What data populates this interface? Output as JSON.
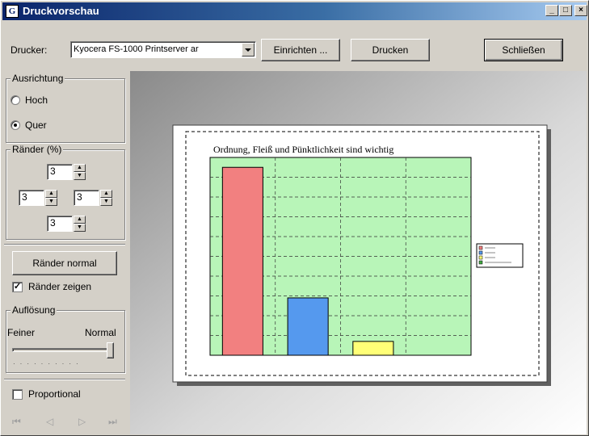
{
  "window": {
    "title": "Druckvorschau",
    "icon_letter": "G",
    "minimize_glyph": "_",
    "maximize_glyph": "□",
    "close_glyph": "×"
  },
  "toolbar": {
    "printer_label": "Drucker:",
    "printer_value": "Kyocera FS-1000 Printserver ar",
    "setup_button": "Einrichten ...",
    "print_button": "Drucken",
    "close_button": "Schließen"
  },
  "orientation": {
    "title": "Ausrichtung",
    "portrait": "Hoch",
    "landscape": "Quer",
    "selected": "landscape"
  },
  "margins": {
    "title": "Ränder (%)",
    "top": "3",
    "left": "3",
    "right": "3",
    "bottom": "3",
    "normal_button": "Ränder normal",
    "show_label": "Ränder zeigen",
    "show_checked": true
  },
  "resolution": {
    "title": "Auflösung",
    "finer_label": "Feiner",
    "normal_label": "Normal",
    "slider_level": 1.0
  },
  "proportional": {
    "label": "Proportional",
    "checked": false
  },
  "nav_icons": [
    "first-page-icon",
    "prev-page-icon",
    "next-page-icon",
    "last-page-icon"
  ],
  "colors": {
    "titlebar_start": "#0a246a",
    "titlebar_end": "#a6caf0",
    "plot_bg": "#b8f5b8",
    "bar1": "#f28080",
    "bar2": "#5599ee",
    "bar3": "#ffff77"
  },
  "chart_data": {
    "type": "bar",
    "title": "Ordnung, Fleiß und Pünktlichkeit sind wichtig",
    "categories": [
      "",
      "",
      "",
      ""
    ],
    "values": [
      95,
      29,
      7,
      0
    ],
    "ylim": [
      0,
      100
    ],
    "grid": true,
    "legend_placement": "right",
    "legend_entries": [
      "",
      "",
      "",
      ""
    ]
  }
}
